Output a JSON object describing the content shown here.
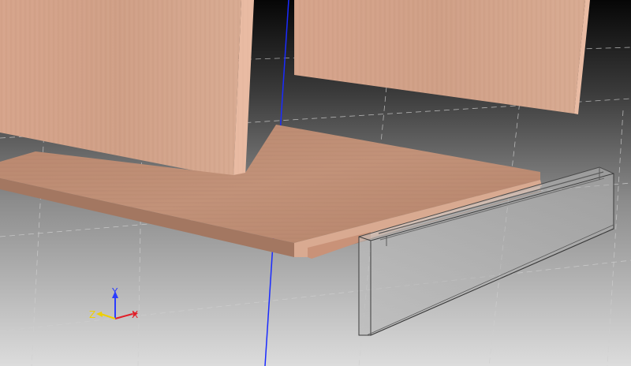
{
  "viewport": {
    "background_top": "#080808",
    "background_bottom": "#d9d9d9",
    "grid_color": "#c8c8c8",
    "axis_line_color": "#1a2bff",
    "wood_light": "#d9a98f",
    "wood_mid": "#c99a82",
    "wood_edge": "#e8b9a0",
    "glass_fill": "#b5b5b5",
    "glass_stroke": "#4a4a4a"
  },
  "triad": {
    "x_label": "X",
    "y_label": "Y",
    "z_label": "Z",
    "x_color": "#e0202a",
    "y_color": "#2a3cff",
    "z_color": "#f0d000"
  }
}
